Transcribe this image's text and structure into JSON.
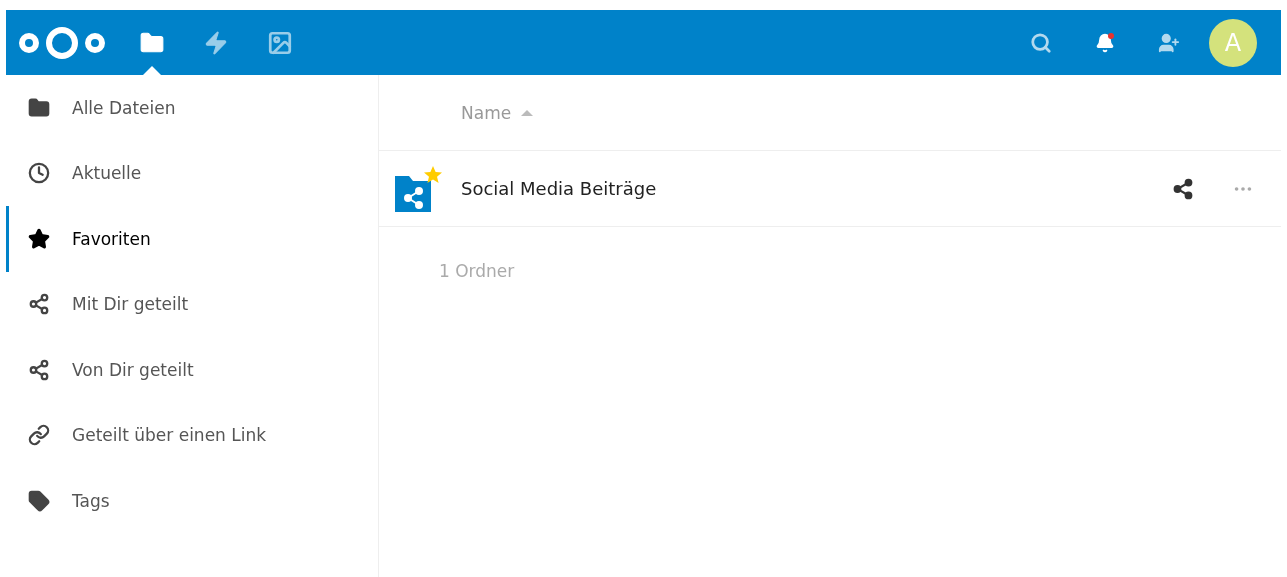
{
  "header": {
    "apps": [
      {
        "kind": "files",
        "selected": true
      },
      {
        "kind": "activity",
        "selected": false
      },
      {
        "kind": "gallery",
        "selected": false
      }
    ],
    "notifications": {
      "unread": true
    },
    "avatar": {
      "initial": "A"
    }
  },
  "sidebar": {
    "items": [
      {
        "label": "Alle Dateien",
        "selected": false
      },
      {
        "label": "Aktuelle",
        "selected": false
      },
      {
        "label": "Favoriten",
        "selected": true
      },
      {
        "label": "Mit Dir geteilt",
        "selected": false
      },
      {
        "label": "Von Dir geteilt",
        "selected": false
      },
      {
        "label": "Geteilt über einen Link",
        "selected": false
      },
      {
        "label": "Tags",
        "selected": false
      }
    ]
  },
  "table": {
    "columns": [
      {
        "label": "Name"
      }
    ],
    "rows": [
      {
        "name": "Social Media Beiträge",
        "favorite": true
      }
    ],
    "summary": "1 Ordner"
  }
}
